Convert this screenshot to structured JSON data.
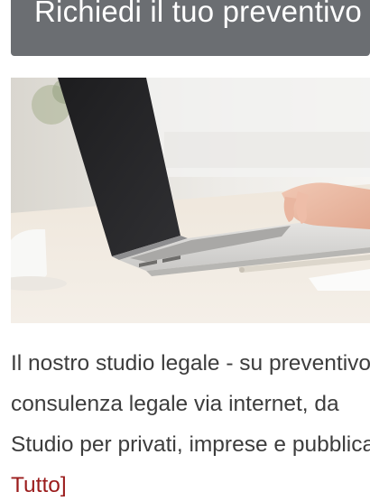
{
  "banner": {
    "text": "Richiedi il tuo preventivo"
  },
  "article": {
    "image_alt": "Laptop su una scrivania",
    "lines": [
      "Il nostro studio legale - su preventivo",
      "consulenza legale via internet, da",
      "Studio per privati, imprese e pubblica"
    ],
    "read_more": "Tutto]"
  },
  "colors": {
    "banner_bg": "#6b6e72",
    "body_text": "#3d3d3d",
    "link": "#9b1c1c"
  }
}
